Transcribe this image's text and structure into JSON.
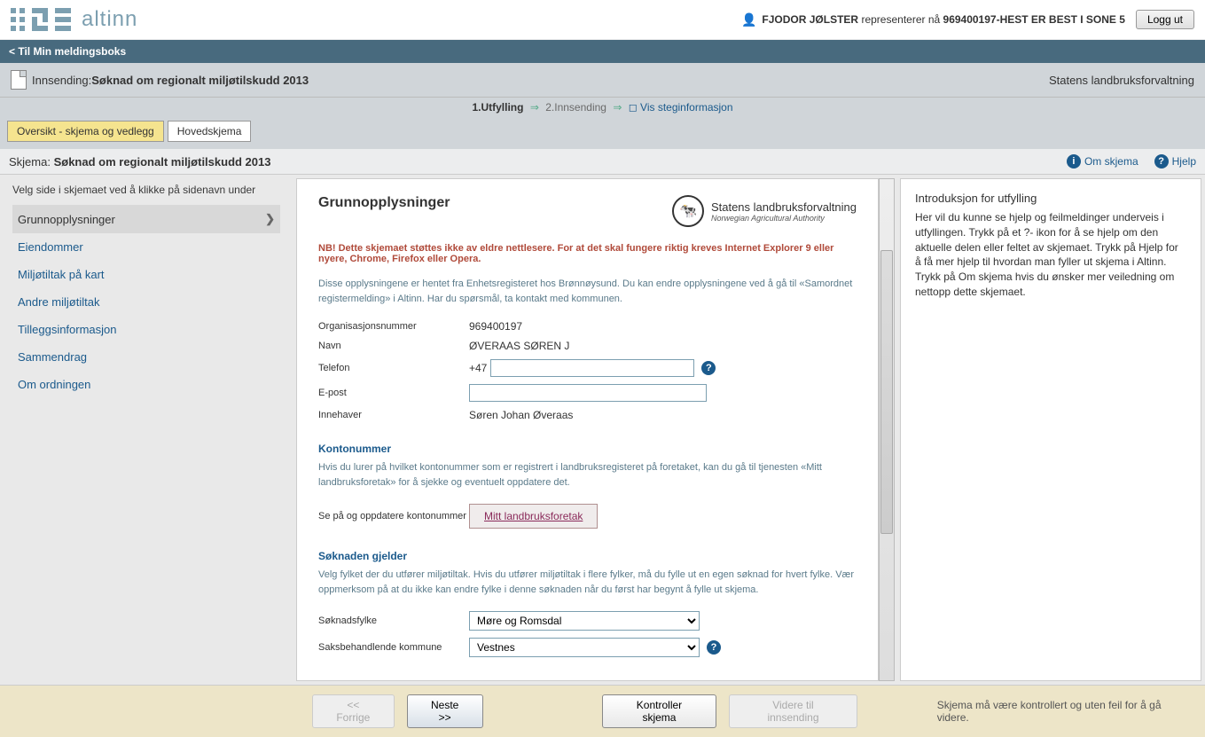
{
  "header": {
    "logo_text": "altinn",
    "user_prefix": "FJODOR JØLSTER",
    "user_middle": "representerer nå",
    "user_org": "969400197-HEST ER BEST I SONE 5",
    "logout": "Logg ut"
  },
  "back_bar": "< Til Min meldingsboks",
  "submission": {
    "label": "Innsending:",
    "title": "Søknad om regionalt miljøtilskudd 2013",
    "agency": "Statens landbruksforvaltning"
  },
  "steps": {
    "step1": "1.Utfylling",
    "step2": "2.Innsending",
    "info_link": "Vis steginformasjon"
  },
  "tabs": {
    "overview": "Oversikt - skjema og vedlegg",
    "main": "Hovedskjema"
  },
  "schema": {
    "label": "Skjema:",
    "title": "Søknad om regionalt miljøtilskudd 2013",
    "about": "Om skjema",
    "help": "Hjelp"
  },
  "sidebar": {
    "hint": "Velg side i skjemaet ved å klikke på sidenavn under",
    "items": [
      "Grunnopplysninger",
      "Eiendommer",
      "Miljøtiltak på kart",
      "Andre miljøtiltak",
      "Tilleggsinformasjon",
      "Sammendrag",
      "Om ordningen"
    ]
  },
  "content": {
    "title": "Grunnopplysninger",
    "agency_name": "Statens landbruksforvaltning",
    "agency_sub": "Norwegian Agricultural Authority",
    "warning": "NB! Dette skjemaet støttes ikke av eldre nettlesere. For at det skal fungere riktig kreves Internet Explorer 9 eller nyere, Chrome, Firefox eller Opera.",
    "info1": "Disse opplysningene er hentet fra Enhetsregisteret hos Brønnøysund. Du kan endre opplysningene ved å gå til «Samordnet registermelding» i Altinn. Har du spørsmål, ta kontakt med kommunen.",
    "org_label": "Organisasjonsnummer",
    "org_value": "969400197",
    "name_label": "Navn",
    "name_value": "ØVERAAS SØREN J",
    "phone_label": "Telefon",
    "phone_prefix": "+47",
    "phone_value": "",
    "email_label": "E-post",
    "email_value": "",
    "owner_label": "Innehaver",
    "owner_value": "Søren Johan Øveraas",
    "konto_title": "Kontonummer",
    "konto_info": "Hvis du lurer på hvilket kontonummer som er registrert i landbruksregisteret på foretaket, kan du gå til tjenesten «Mitt landbruksforetak» for å sjekke og eventuelt oppdatere det.",
    "konto_label": "Se på og oppdatere kontonummer",
    "konto_link": "Mitt landbruksforetak",
    "soknad_title": "Søknaden gjelder",
    "soknad_info": "Velg fylket der du utfører miljøtiltak. Hvis du utfører miljøtiltak i flere fylker, må du fylle ut en egen søknad for hvert fylke. Vær oppmerksom på at du ikke kan endre fylke i denne søknaden når du først har begynt å fylle ut skjema.",
    "fylke_label": "Søknadsfylke",
    "fylke_value": "Møre og Romsdal",
    "kommune_label": "Saksbehandlende kommune",
    "kommune_value": "Vestnes"
  },
  "right": {
    "title": "Introduksjon for utfylling",
    "text": "Her vil du kunne se hjelp og feilmeldinger underveis i utfyllingen. Trykk på et ?- ikon for å se hjelp om den aktuelle delen eller feltet av skjemaet. Trykk på Hjelp for å få mer hjelp til hvordan man fyller ut skjema i Altinn. Trykk på Om skjema hvis du ønsker mer veiledning om nettopp dette skjemaet."
  },
  "footer": {
    "prev": "<< Forrige",
    "next": "Neste >>",
    "check": "Kontroller skjema",
    "submit": "Videre til innsending",
    "hint": "Skjema må være kontrollert og uten feil for å gå videre."
  }
}
